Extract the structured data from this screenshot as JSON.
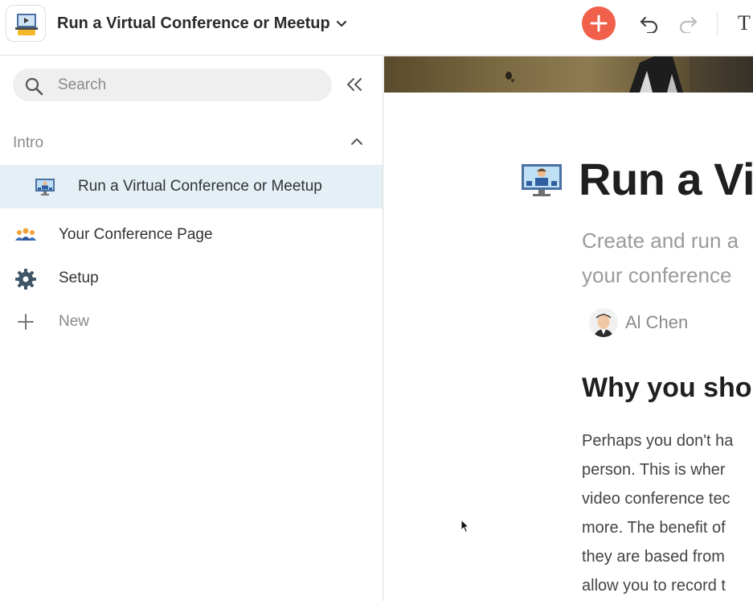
{
  "topbar": {
    "doc_title": "Run a Virtual Conference or Meetup",
    "text_tool_glyph": "T",
    "icons": {
      "doc": "presentation-icon",
      "title_menu": "chevron-down-icon",
      "add": "plus-icon",
      "undo": "undo-icon",
      "redo": "redo-icon"
    }
  },
  "sidebar": {
    "search": {
      "placeholder": "Search",
      "value": ""
    },
    "section": {
      "label": "Intro",
      "expanded": true
    },
    "items": [
      {
        "label": "Run a Virtual Conference or Meetup",
        "icon": "video-conference-icon",
        "active": true
      },
      {
        "label": "Your Conference Page",
        "icon": "people-icon",
        "active": false
      },
      {
        "label": "Setup",
        "icon": "gear-icon",
        "active": false
      },
      {
        "label": "New",
        "icon": "plus-icon",
        "active": false
      }
    ]
  },
  "page": {
    "title": "Run a Vi",
    "subtitle_lines": [
      "Create and run a",
      "your conference"
    ],
    "author": "Al Chen",
    "heading": "Why you sho",
    "body_lines": [
      "Perhaps you don't ha",
      "person. This is wher",
      "video conference tec",
      "more. The benefit of",
      "they are based from",
      "allow you to record t"
    ]
  },
  "colors": {
    "accent_add": "#f0604a",
    "active_item_bg": "#e4f0f6",
    "muted_text": "#8a8a8a"
  }
}
